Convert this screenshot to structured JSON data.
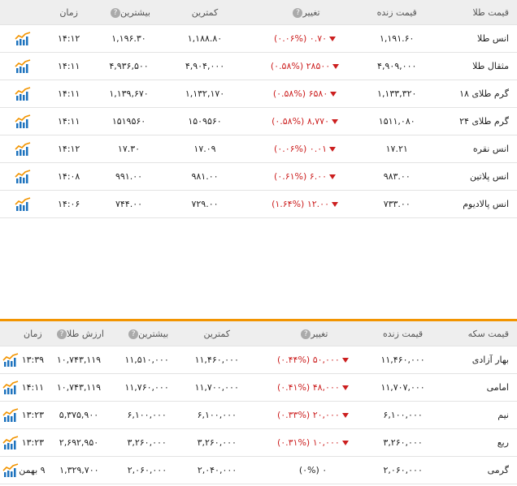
{
  "gold": {
    "headers": {
      "name": "قیمت طلا",
      "live": "قیمت زنده",
      "change": "تغییر",
      "low": "کمترین",
      "high": "بیشترین",
      "time": "زمان"
    },
    "rows": [
      {
        "name": "انس طلا",
        "live": "۱,۱۹۱.۶۰",
        "change": "۰.۷۰ (۰.۰۶%)",
        "low": "۱,۱۸۸.۸۰",
        "high": "۱,۱۹۶.۳۰",
        "time": "۱۴:۱۲"
      },
      {
        "name": "مثقال طلا",
        "live": "۴,۹۰۹,۰۰۰",
        "change": "۲۸۵۰۰ (۰.۵۸%)",
        "low": "۴,۹۰۴,۰۰۰",
        "high": "۴,۹۳۶,۵۰۰",
        "time": "۱۴:۱۱"
      },
      {
        "name": "گرم طلای ۱۸",
        "live": "۱,۱۳۳,۳۲۰",
        "change": "۶۵۸۰ (۰.۵۸%)",
        "low": "۱,۱۳۲,۱۷۰",
        "high": "۱,۱۳۹,۶۷۰",
        "time": "۱۴:۱۱"
      },
      {
        "name": "گرم طلای ۲۴",
        "live": "۱۵۱۱,۰۸۰",
        "change": "۸,۷۷۰ (۰.۵۸%)",
        "low": "۱۵۰۹۵۶۰",
        "high": "۱۵۱۹۵۶۰",
        "time": "۱۴:۱۱"
      },
      {
        "name": "انس نقره",
        "live": "۱۷.۲۱",
        "change": "۰.۰۱ (۰.۰۶%)",
        "low": "۱۷.۰۹",
        "high": "۱۷.۳۰",
        "time": "۱۴:۱۲"
      },
      {
        "name": "انس پلاتین",
        "live": "۹۸۳.۰۰",
        "change": "۶.۰۰ (۰.۶۱%)",
        "low": "۹۸۱.۰۰",
        "high": "۹۹۱.۰۰",
        "time": "۱۴:۰۸"
      },
      {
        "name": "انس پالادیوم",
        "live": "۷۳۳.۰۰",
        "change": "۱۲.۰۰ (۱.۶۴%)",
        "low": "۷۲۹.۰۰",
        "high": "۷۴۴.۰۰",
        "time": "۱۴:۰۶"
      }
    ]
  },
  "coin": {
    "headers": {
      "name": "قیمت سکه",
      "live": "قیمت زنده",
      "change": "تغییر",
      "low": "کمترین",
      "high": "بیشترین",
      "gold_value": "ارزش طلا",
      "time": "زمان"
    },
    "rows": [
      {
        "name": "بهار آزادی",
        "live": "۱۱,۴۶۰,۰۰۰",
        "change": "۵۰,۰۰۰ (۰.۴۴%)",
        "neg": true,
        "low": "۱۱,۴۶۰,۰۰۰",
        "high": "۱۱,۵۱۰,۰۰۰",
        "gold_value": "۱۰,۷۴۳,۱۱۹",
        "time": "۱۳:۳۹"
      },
      {
        "name": "امامی",
        "live": "۱۱,۷۰۷,۰۰۰",
        "change": "۴۸,۰۰۰ (۰.۴۱%)",
        "neg": true,
        "low": "۱۱,۷۰۰,۰۰۰",
        "high": "۱۱,۷۶۰,۰۰۰",
        "gold_value": "۱۰,۷۴۳,۱۱۹",
        "time": "۱۴:۱۱"
      },
      {
        "name": "نیم",
        "live": "۶,۱۰۰,۰۰۰",
        "change": "۲۰,۰۰۰ (۰.۳۳%)",
        "neg": true,
        "low": "۶,۱۰۰,۰۰۰",
        "high": "۶,۱۰۰,۰۰۰",
        "gold_value": "۵,۳۷۵,۹۰۰",
        "time": "۱۳:۲۳"
      },
      {
        "name": "ربع",
        "live": "۳,۲۶۰,۰۰۰",
        "change": "۱۰,۰۰۰ (۰.۳۱%)",
        "neg": true,
        "low": "۳,۲۶۰,۰۰۰",
        "high": "۳,۲۶۰,۰۰۰",
        "gold_value": "۲,۶۹۲,۹۵۰",
        "time": "۱۳:۲۳"
      },
      {
        "name": "گرمی",
        "live": "۲,۰۶۰,۰۰۰",
        "change": "۰ (۰%)",
        "neg": false,
        "low": "۲,۰۴۰,۰۰۰",
        "high": "۲,۰۶۰,۰۰۰",
        "gold_value": "۱,۳۲۹,۷۰۰",
        "time": "۹ بهمن"
      }
    ]
  },
  "icons": {
    "info": "question-icon",
    "chart": "bar-chart-icon",
    "down": "down-triangle-icon"
  },
  "colors": {
    "accent": "#f29400",
    "negative": "#cc1f1f",
    "header_bg": "#eeeeee",
    "chart_blue": "#1e73be"
  }
}
